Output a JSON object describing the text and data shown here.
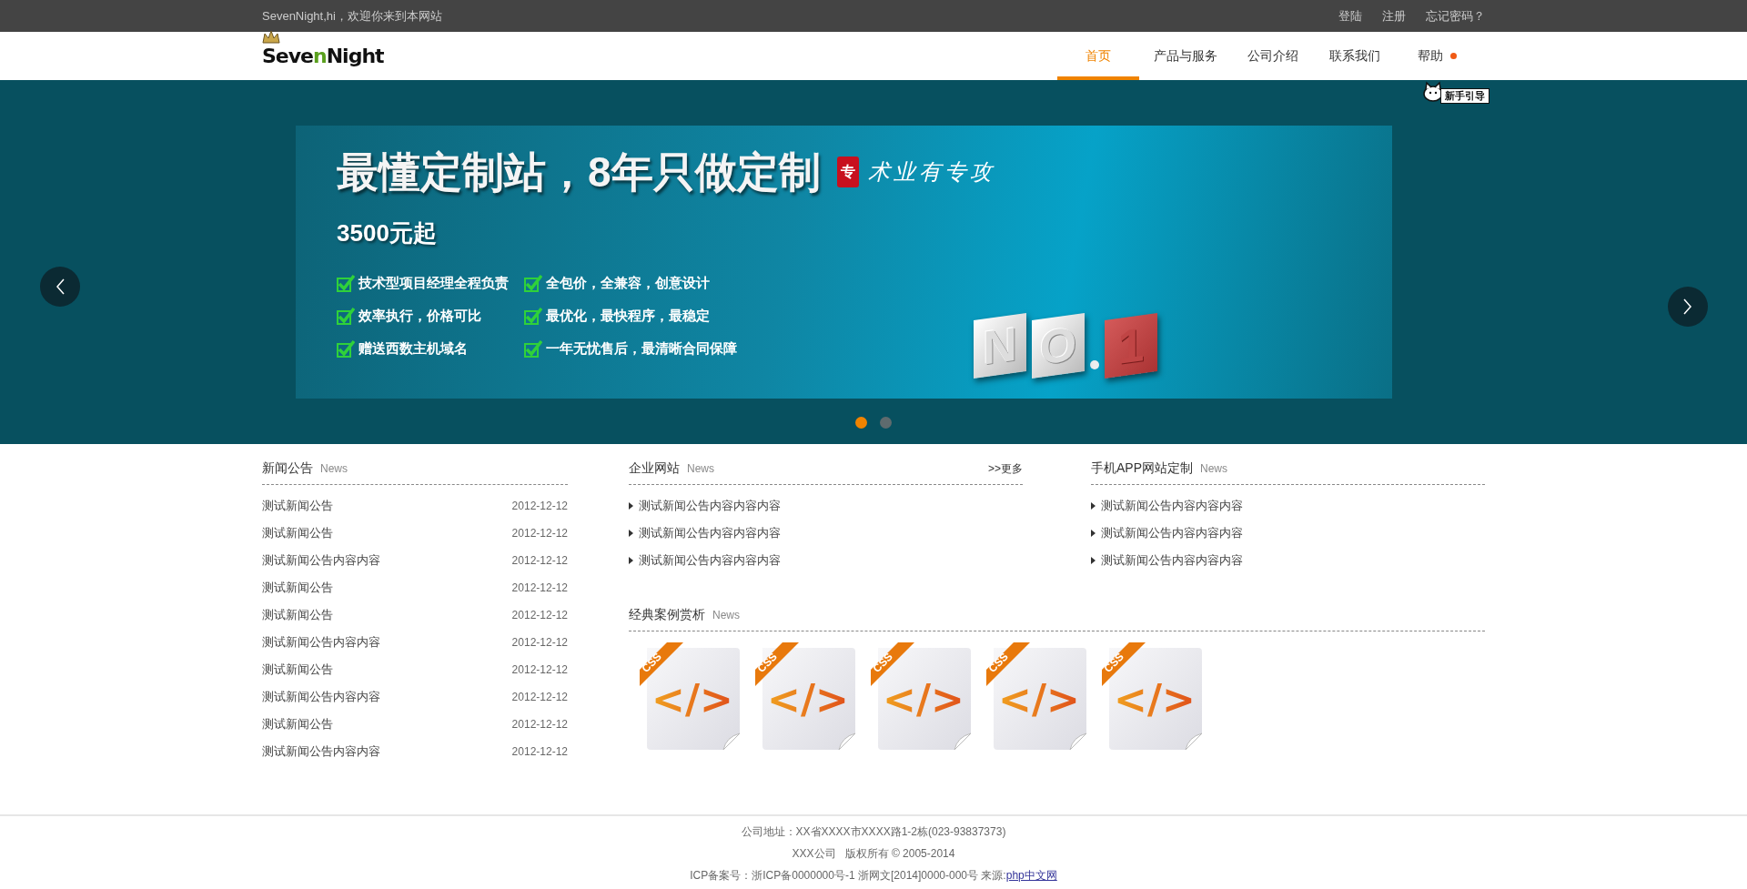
{
  "top_bar": {
    "greeting": "SevenNight,hi，欢迎你来到本网站",
    "links": [
      "登陆",
      "注册",
      "忘记密码？"
    ]
  },
  "header": {
    "logo": [
      {
        "text": "Seve",
        "accent": false
      },
      {
        "text": "n",
        "accent": true
      },
      {
        "text": "Night",
        "accent": false
      }
    ],
    "nav": [
      {
        "label": "首页",
        "selected": true,
        "dot": false
      },
      {
        "label": "产品与服务",
        "selected": false,
        "dot": false
      },
      {
        "label": "公司介绍",
        "selected": false,
        "dot": false
      },
      {
        "label": "联系我们",
        "selected": false,
        "dot": false
      },
      {
        "label": "帮助",
        "selected": false,
        "dot": true
      }
    ],
    "guide_badge": "新手引导"
  },
  "banner": {
    "headline": "最懂定制站，8年只做定制",
    "seal": "专",
    "slogan": "术业有专攻",
    "price": "3500元起",
    "features": [
      "技术型项目经理全程负责",
      "全包价，全兼容，创意设计",
      "效率执行，价格可比",
      "最优化，最快程序，最稳定",
      "赠送西数主机域名",
      "一年无忧售后，最清晰合同保障"
    ],
    "tiles": [
      "N",
      "O",
      "1"
    ],
    "slides": [
      {
        "selected": true
      },
      {
        "selected": false
      }
    ]
  },
  "news": {
    "title": "新闻公告",
    "subtitle": "News",
    "items": [
      {
        "title": "测试新闻公告",
        "date": "2012-12-12"
      },
      {
        "title": "测试新闻公告",
        "date": "2012-12-12"
      },
      {
        "title": "测试新闻公告内容内容",
        "date": "2012-12-12"
      },
      {
        "title": "测试新闻公告",
        "date": "2012-12-12"
      },
      {
        "title": "测试新闻公告",
        "date": "2012-12-12"
      },
      {
        "title": "测试新闻公告内容内容",
        "date": "2012-12-12"
      },
      {
        "title": "测试新闻公告",
        "date": "2012-12-12"
      },
      {
        "title": "测试新闻公告内容内容",
        "date": "2012-12-12"
      },
      {
        "title": "测试新闻公告",
        "date": "2012-12-12"
      },
      {
        "title": "测试新闻公告内容内容",
        "date": "2012-12-12"
      }
    ]
  },
  "enterprise": {
    "title": "企业网站",
    "subtitle": "News",
    "more": ">>更多",
    "items": [
      "测试新闻公告内容内容内容",
      "测试新闻公告内容内容内容",
      "测试新闻公告内容内容内容"
    ]
  },
  "app": {
    "title": "手机APP网站定制",
    "subtitle": "News",
    "items": [
      "测试新闻公告内容内容内容",
      "测试新闻公告内容内容内容",
      "测试新闻公告内容内容内容"
    ]
  },
  "cases": {
    "title": "经典案例赏析",
    "subtitle": "News",
    "items": [
      {
        "ribbon": "CSS",
        "glyph": "</>"
      },
      {
        "ribbon": "CSS",
        "glyph": "</>"
      },
      {
        "ribbon": "CSS",
        "glyph": "</>"
      },
      {
        "ribbon": "CSS",
        "glyph": "</>"
      },
      {
        "ribbon": "CSS",
        "glyph": "</>"
      }
    ]
  },
  "footer": {
    "address": "公司地址：XX省XXXX市XXXX路1-2栋(023-93837373)",
    "copyright": "XXX公司   版权所有 © 2005-2014",
    "icp": "ICP备案号：浙ICP备0000000号-1 浙网文[2014]0000-000号 来源:",
    "link": "php中文网"
  }
}
